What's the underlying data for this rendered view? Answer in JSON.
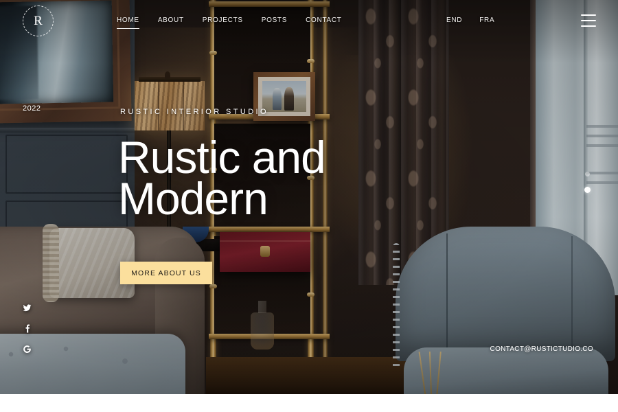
{
  "brand": {
    "logo_letter": "R",
    "logo_name": "rustic-studio-monogram"
  },
  "nav": {
    "items": [
      {
        "label": "HOME",
        "active": true
      },
      {
        "label": "ABOUT",
        "active": false
      },
      {
        "label": "PROJECTS",
        "active": false
      },
      {
        "label": "POSTS",
        "active": false
      },
      {
        "label": "CONTACT",
        "active": false
      }
    ],
    "languages": [
      {
        "label": "END"
      },
      {
        "label": "FRA"
      }
    ],
    "menu_icon": "hamburger-menu-icon"
  },
  "hero": {
    "year": "2022",
    "eyebrow": "RUSTIC INTERIOR STUDIO",
    "headline_line1": "Rustic and",
    "headline_line2": "Modern",
    "cta_label": "MORE ABOUT US",
    "cta_color": "#fbdf9d",
    "cta_text_color": "#1d1a16",
    "text_color": "#ffffff"
  },
  "social": {
    "items": [
      {
        "name": "twitter-icon",
        "label": "Twitter"
      },
      {
        "name": "facebook-icon",
        "label": "Facebook"
      },
      {
        "name": "google-icon",
        "label": "Google"
      }
    ]
  },
  "slider": {
    "dots": [
      {
        "active": false
      },
      {
        "active": true
      }
    ]
  },
  "contact": {
    "email": "CONTACT@RUSTICTUDIO.CO"
  }
}
